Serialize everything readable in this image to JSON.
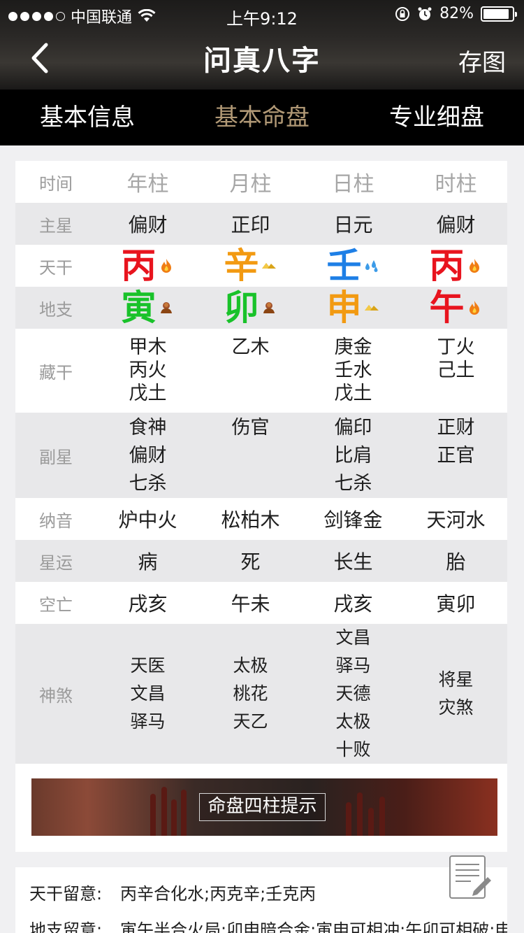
{
  "status_bar": {
    "carrier": "中国联通",
    "time": "上午9:12",
    "battery_percent": "82%",
    "battery_level": 0.82
  },
  "nav": {
    "title": "问真八字",
    "right_action": "存图",
    "back_icon": "chevron-left-icon"
  },
  "tabs": [
    {
      "label": "基本信息",
      "active": false
    },
    {
      "label": "基本命盘",
      "active": true
    },
    {
      "label": "专业细盘",
      "active": false
    }
  ],
  "chart": {
    "header": {
      "label": "时间",
      "cols": [
        "年柱",
        "月柱",
        "日柱",
        "时柱"
      ]
    },
    "main_star": {
      "label": "主星",
      "cols": [
        "偏财",
        "正印",
        "日元",
        "偏财"
      ]
    },
    "tiangan": {
      "label": "天干",
      "cols": [
        {
          "char": "丙",
          "color": "#e8141e",
          "icon": "fire-icon"
        },
        {
          "char": "辛",
          "color": "#f29a12",
          "icon": "metal-ingot-icon"
        },
        {
          "char": "壬",
          "color": "#1e7fe6",
          "icon": "water-drops-icon"
        },
        {
          "char": "丙",
          "color": "#e8141e",
          "icon": "fire-icon"
        }
      ]
    },
    "dizhi": {
      "label": "地支",
      "cols": [
        {
          "char": "寅",
          "color": "#19c22a",
          "icon": "wood-icon"
        },
        {
          "char": "卯",
          "color": "#19c22a",
          "icon": "wood-icon"
        },
        {
          "char": "申",
          "color": "#f29a12",
          "icon": "metal-ingot-icon"
        },
        {
          "char": "午",
          "color": "#e8141e",
          "icon": "fire-icon"
        }
      ]
    },
    "canggan": {
      "label": "藏干",
      "cols": [
        [
          "甲木",
          "丙火",
          "戊土"
        ],
        [
          "乙木"
        ],
        [
          "庚金",
          "壬水",
          "戊土"
        ],
        [
          "丁火",
          "己土"
        ]
      ]
    },
    "fuxing": {
      "label": "副星",
      "cols": [
        [
          "食神",
          "偏财",
          "七杀"
        ],
        [
          "伤官"
        ],
        [
          "偏印",
          "比肩",
          "七杀"
        ],
        [
          "正财",
          "正官"
        ]
      ]
    },
    "nayin": {
      "label": "纳音",
      "cols": [
        "炉中火",
        "松柏木",
        "剑锋金",
        "天河水"
      ]
    },
    "xingyun": {
      "label": "星运",
      "cols": [
        "病",
        "死",
        "长生",
        "胎"
      ]
    },
    "kongwang": {
      "label": "空亡",
      "cols": [
        "戌亥",
        "午未",
        "戌亥",
        "寅卯"
      ]
    },
    "shensha": {
      "label": "神煞",
      "cols": [
        [
          "天医",
          "文昌",
          "驿马"
        ],
        [
          "太极",
          "桃花",
          "天乙"
        ],
        [
          "文昌",
          "驿马",
          "天德",
          "太极",
          "十败"
        ],
        [
          "将星",
          "灾煞"
        ]
      ]
    }
  },
  "banner": {
    "button_label": "命盘四柱提示"
  },
  "notes": {
    "tiangan_key": "天干留意:",
    "tiangan_value": "丙辛合化水;丙克辛;壬克丙",
    "dizhi_key": "地支留意:",
    "dizhi_value": "寅午半合火局;卯申暗合金;寅申可相冲;午卯可相破;申"
  },
  "fab_icon": "edit-document-icon"
}
